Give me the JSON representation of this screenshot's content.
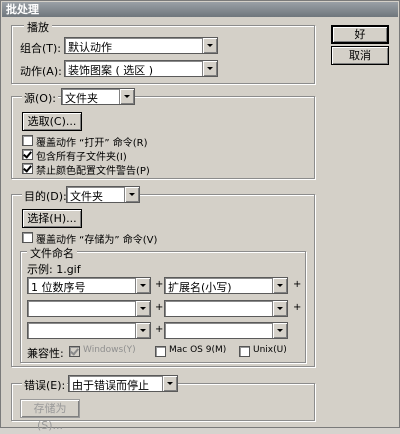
{
  "window": {
    "title": "批处理"
  },
  "play": {
    "legend": "播放",
    "set_label": "组合(T):",
    "set_value": "默认动作",
    "action_label": "动作(A):",
    "action_value": "装饰图案 ( 选区 )"
  },
  "source": {
    "label": "源(O):",
    "value": "文件夹",
    "choose_button": "选取(C)...",
    "override_open": {
      "label": "覆盖动作 “打开” 命令(R)",
      "checked": false
    },
    "include_subfolders": {
      "label": "包含所有子文件夹(I)",
      "checked": true
    },
    "suppress_color": {
      "label": "禁止颜色配置文件警告(P)",
      "checked": true
    }
  },
  "destination": {
    "label": "目的(D):",
    "value": "文件夹",
    "choose_button": "选择(H)...",
    "override_save": {
      "label": "覆盖动作 “存储为” 命令(V)",
      "checked": false
    }
  },
  "file_naming": {
    "legend": "文件命名",
    "example": "示例: 1.gif",
    "field1": "1 位数序号",
    "field2": "扩展名(小写)",
    "field3": "",
    "field4": "",
    "field5": "",
    "field6": "",
    "plus": "+",
    "compat_label": "兼容性:",
    "windows": {
      "label": "Windows(Y)",
      "checked": true,
      "disabled": true
    },
    "macos9": {
      "label": "Mac OS 9(M)",
      "checked": false
    },
    "unix": {
      "label": "Unix(U)",
      "checked": false
    }
  },
  "errors": {
    "label": "错误(E):",
    "value": "由于错误而停止",
    "save_as_button": "存储为(S)..."
  },
  "buttons": {
    "ok": "好",
    "cancel": "取消"
  }
}
